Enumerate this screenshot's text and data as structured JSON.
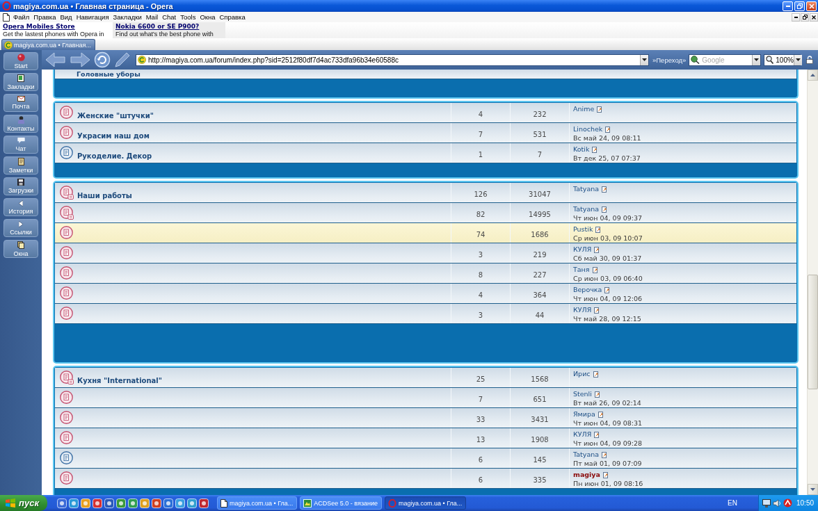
{
  "window": {
    "title": "magiya.com.ua • Главная страница - Opera"
  },
  "menu": [
    "Файл",
    "Правка",
    "Вид",
    "Навигация",
    "Закладки",
    "Mail",
    "Chat",
    "Tools",
    "Окна",
    "Справка"
  ],
  "ads": [
    {
      "title": "Opera Mobiles Store",
      "text": "Get the lastest phones with Opera in",
      "highlighted": false
    },
    {
      "title": "Nokia 6600 or SE P900?",
      "text": "Find out what's the best phone with",
      "highlighted": true
    }
  ],
  "tabs": [
    {
      "label": "magiya.com.ua • Главная...",
      "selected": true
    }
  ],
  "panel": {
    "items": [
      {
        "kind": "start",
        "label": "Start"
      },
      {
        "kind": "bookmarks",
        "label": "Закладки"
      },
      {
        "kind": "mail",
        "label": "Почта"
      },
      {
        "kind": "contacts",
        "label": "Контакты"
      },
      {
        "kind": "chat",
        "label": "Чат"
      },
      {
        "kind": "notes",
        "label": "Заметки"
      },
      {
        "kind": "transfers",
        "label": "Загрузки"
      },
      {
        "kind": "history",
        "label": "История"
      },
      {
        "kind": "links",
        "label": "Ссылки"
      },
      {
        "kind": "windows",
        "label": "Окна"
      }
    ]
  },
  "address_bar": {
    "url": "http://magiya.com.ua/forum/index.php?sid=2512f80df7d4ac733dfa96b34e60588c",
    "go_label": "»Переход»"
  },
  "search": {
    "placeholder": "Google"
  },
  "zoom": {
    "value": "100%"
  },
  "forum": {
    "sections": [
      {
        "rows": [
          {
            "name": "Головные уборы"
          }
        ]
      },
      {
        "rows": [
          {
            "name": "Женские \"штучки\"",
            "topics": "4",
            "posts": "232",
            "author": "Anime",
            "author_admin": false,
            "new_posts": true,
            "subforums": false,
            "highlighted": false
          },
          {
            "name": "Украсим наш дом",
            "topics": "7",
            "posts": "531",
            "author": "Linochek",
            "date": "Вс май 24, 09 08:11",
            "author_admin": false,
            "new_posts": true,
            "subforums": false,
            "highlighted": false
          },
          {
            "name": "Рукоделие. Декор",
            "topics": "1",
            "posts": "7",
            "author": "Kotik",
            "date": "Вт дек 25, 07 07:37",
            "author_admin": false,
            "new_posts": false,
            "subforums": false,
            "highlighted": false
          }
        ]
      },
      {
        "rows": [
          {
            "name": "Наши работы",
            "topics": "126",
            "posts": "31047",
            "author": "Tatyana",
            "author_admin": false,
            "new_posts": true,
            "subforums": true,
            "highlighted": false
          },
          {
            "topics": "82",
            "posts": "14995",
            "author": "Tatyana",
            "date": "Чт июн 04, 09 09:37",
            "author_admin": false,
            "new_posts": true,
            "subforums": true,
            "highlighted": false
          },
          {
            "topics": "74",
            "posts": "1686",
            "author": "Pustik",
            "date": "Ср июн 03, 09 10:07",
            "author_admin": false,
            "new_posts": true,
            "subforums": false,
            "highlighted": true
          },
          {
            "topics": "3",
            "posts": "219",
            "author": "КУЛЯ",
            "date": "Сб май 30, 09 01:37",
            "author_admin": false,
            "new_posts": true,
            "subforums": false,
            "highlighted": false
          },
          {
            "topics": "8",
            "posts": "227",
            "author": "Таня",
            "date": "Ср июн 03, 09 06:40",
            "author_admin": false,
            "new_posts": true,
            "subforums": false,
            "highlighted": false
          },
          {
            "topics": "4",
            "posts": "364",
            "author": "Верочка",
            "date": "Чт июн 04, 09 12:06",
            "author_admin": false,
            "new_posts": true,
            "subforums": false,
            "highlighted": false
          },
          {
            "topics": "3",
            "posts": "44",
            "author": "КУЛЯ",
            "date": "Чт май 28, 09 12:15",
            "author_admin": false,
            "new_posts": true,
            "subforums": false,
            "highlighted": false
          }
        ]
      },
      {
        "rows": [
          {
            "name": "Кухня \"International\"",
            "topics": "25",
            "posts": "1568",
            "author": "Ирис",
            "author_admin": false,
            "new_posts": true,
            "subforums": true,
            "highlighted": false
          },
          {
            "topics": "7",
            "posts": "651",
            "author": "Stenli",
            "date": "Вт май 26, 09 02:14",
            "author_admin": false,
            "new_posts": true,
            "subforums": false,
            "highlighted": false
          },
          {
            "topics": "33",
            "posts": "3431",
            "author": "Ямира",
            "date": "Чт июн 04, 09 08:31",
            "author_admin": false,
            "new_posts": true,
            "subforums": false,
            "highlighted": false
          },
          {
            "topics": "13",
            "posts": "1908",
            "author": "КУЛЯ",
            "date": "Чт июн 04, 09 09:28",
            "author_admin": false,
            "new_posts": true,
            "subforums": false,
            "highlighted": false
          },
          {
            "topics": "6",
            "posts": "145",
            "author": "Tatyana",
            "date": "Пт май 01, 09 07:09",
            "author_admin": false,
            "new_posts": false,
            "subforums": false,
            "highlighted": false
          },
          {
            "topics": "6",
            "posts": "335",
            "author": "magiya",
            "date": "Пн июн 01, 09 08:16",
            "author_admin": true,
            "new_posts": true,
            "subforums": false,
            "highlighted": false
          }
        ]
      }
    ]
  },
  "taskbar": {
    "start": "пуск",
    "tasks": [
      {
        "kind": "page",
        "label": "magiya.com.ua • Гла...",
        "selected": false
      },
      {
        "kind": "viewer",
        "label": "ACDSee 5.0 - вязание",
        "selected": false
      },
      {
        "kind": "opera",
        "label": "magiya.com.ua • Гла...",
        "selected": true
      }
    ],
    "language": "EN",
    "clock": "10:50"
  }
}
